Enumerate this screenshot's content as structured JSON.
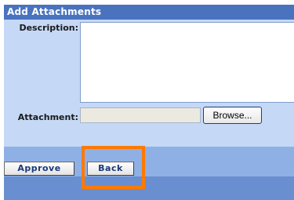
{
  "section": {
    "title": "Add Attachments"
  },
  "form": {
    "description_label": "Description:",
    "description_value": "",
    "attachment_label": "Attachment:",
    "attachment_value": "",
    "browse_label": "Browse..."
  },
  "actions": {
    "approve_label": "Approve",
    "back_label": "Back"
  },
  "colors": {
    "header": "#4a73bf",
    "panel": "#c5d8f5",
    "footer": "#6a8fd0",
    "highlight": "#ff7a00"
  }
}
